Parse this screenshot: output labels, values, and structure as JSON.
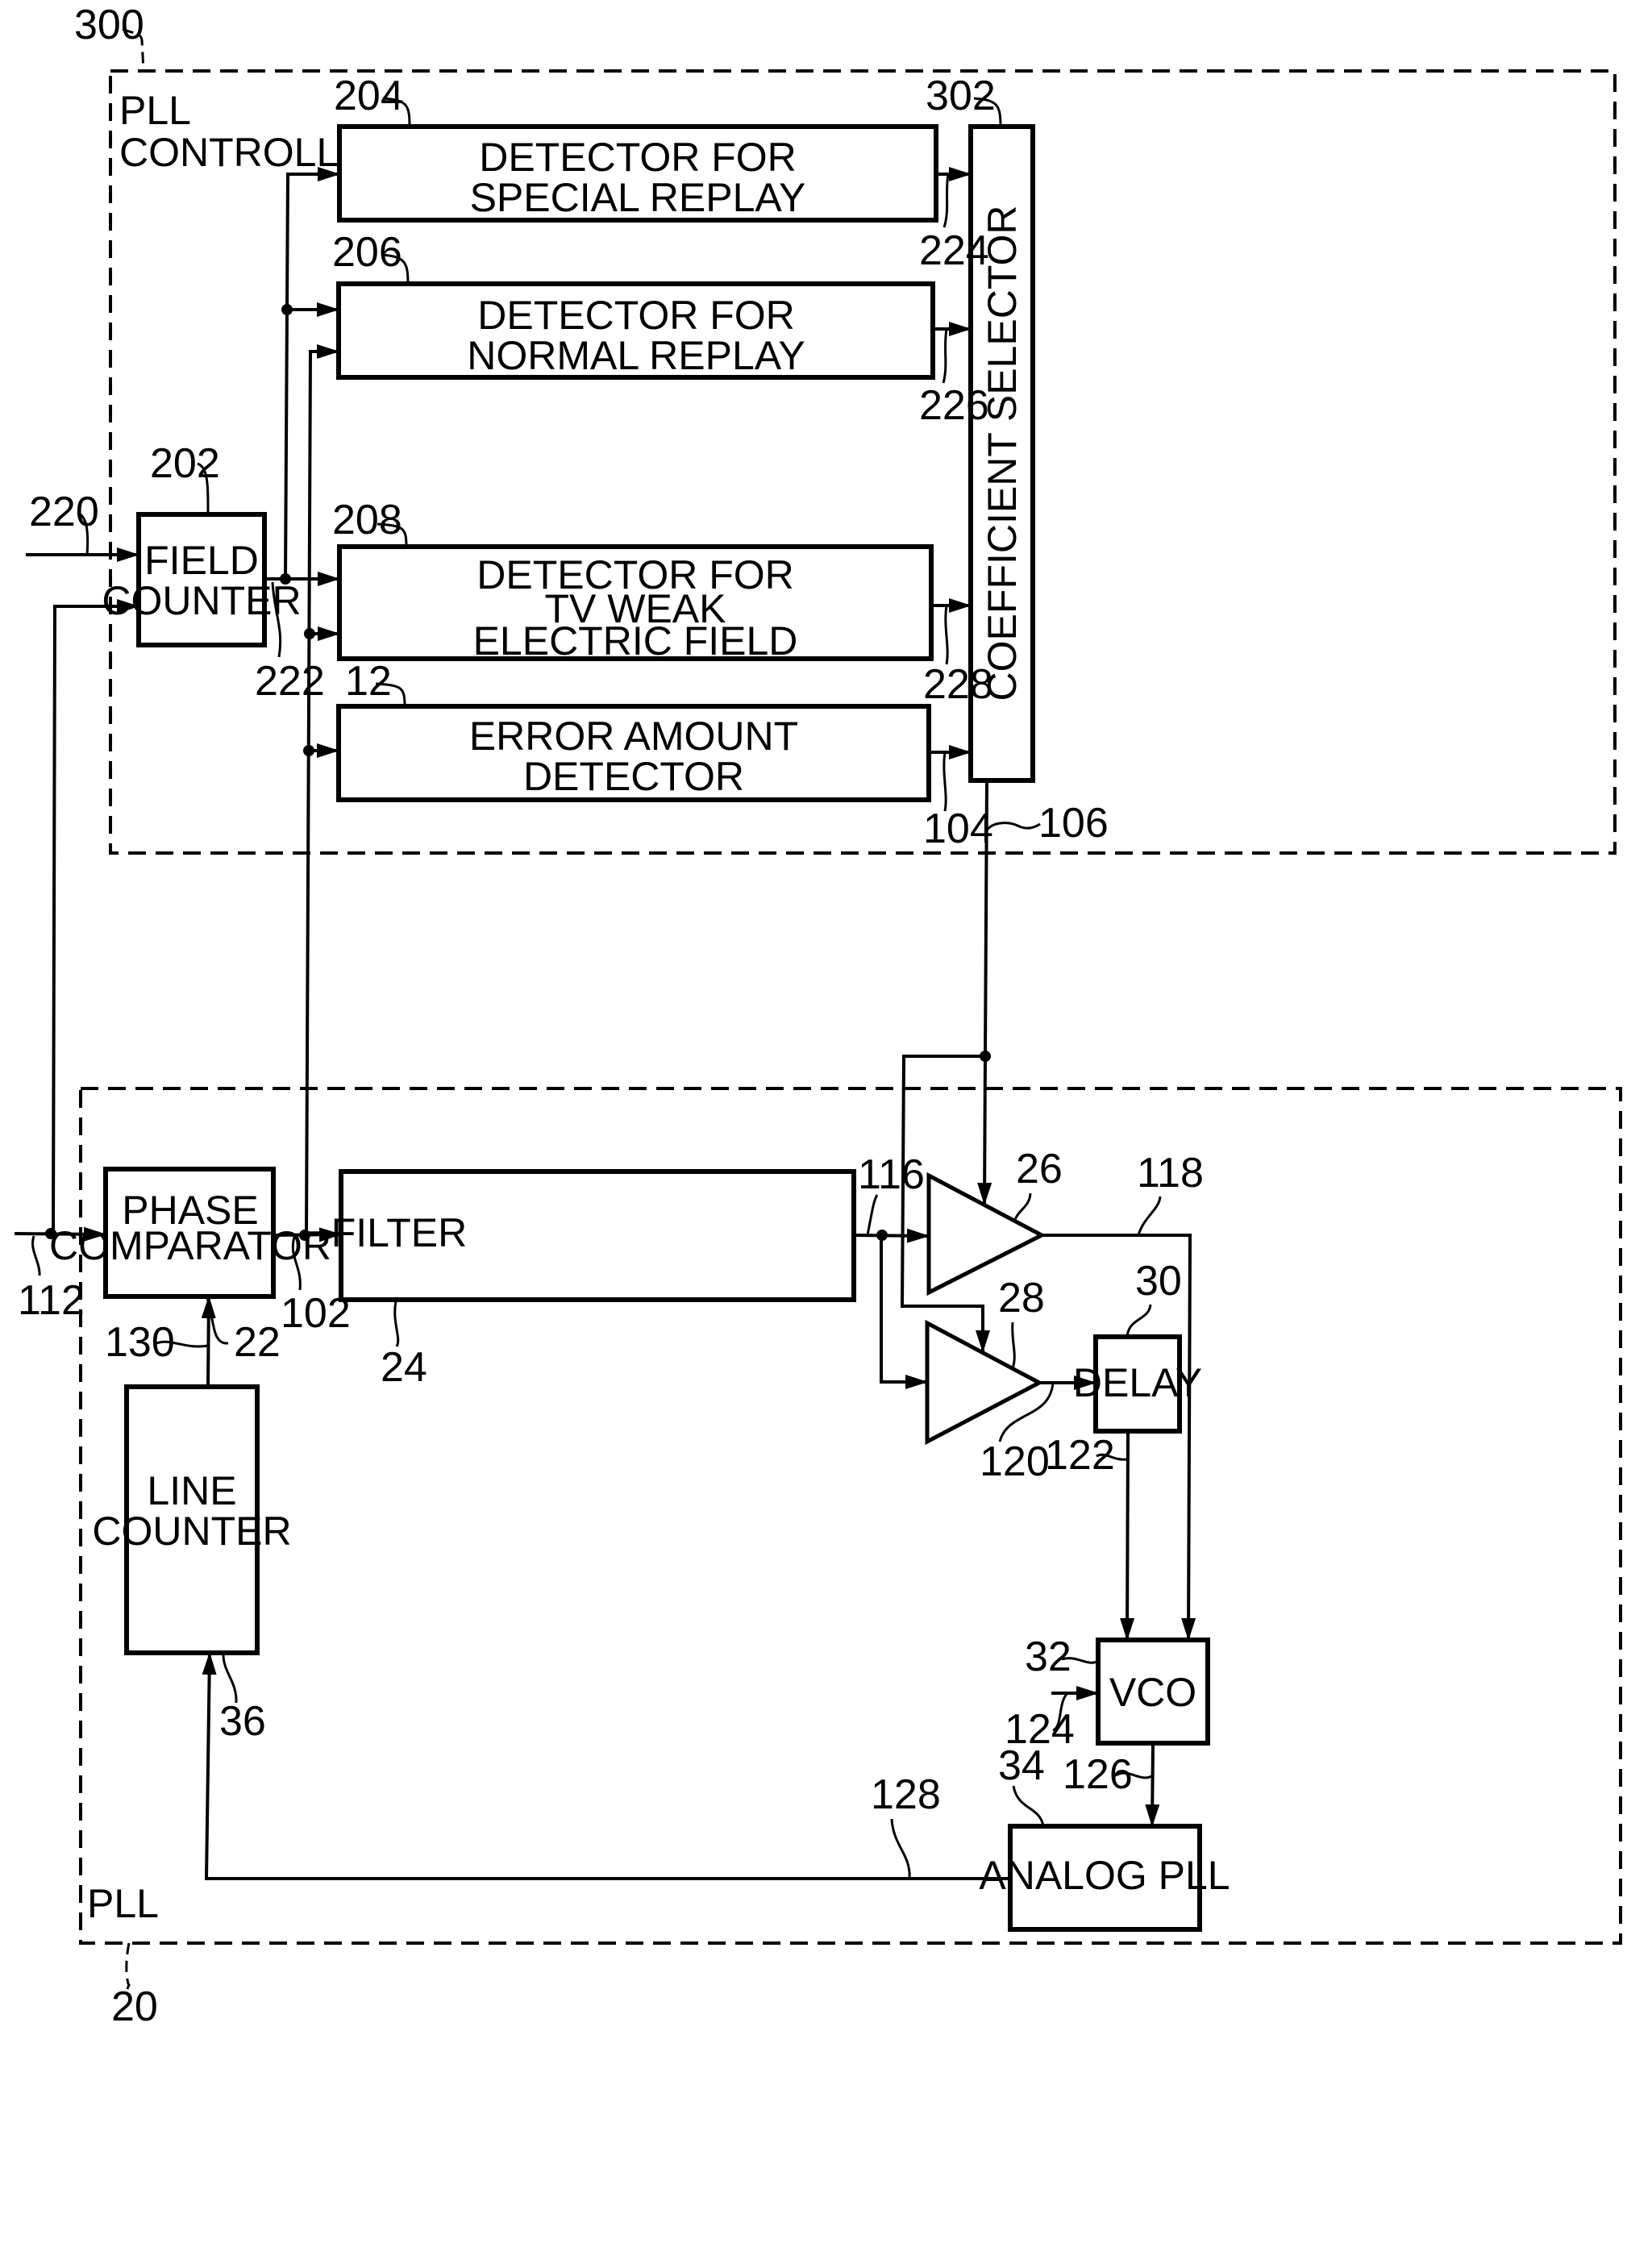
{
  "figure": {
    "groups": {
      "pll_controller": {
        "ref": "300",
        "title_line1": "PLL",
        "title_line2": "CONTROLLER"
      },
      "pll": {
        "ref": "20",
        "title": "PLL"
      }
    },
    "blocks": {
      "field_counter": {
        "ref": "202",
        "line1": "FIELD",
        "line2": "COUNTER"
      },
      "detector_special": {
        "ref": "204",
        "line1": "DETECTOR FOR",
        "line2": "SPECIAL REPLAY"
      },
      "detector_normal": {
        "ref": "206",
        "line1": "DETECTOR FOR",
        "line2": "NORMAL REPLAY"
      },
      "detector_weak": {
        "ref": "208",
        "line1": "DETECTOR FOR",
        "line2": "TV WEAK",
        "line3": "ELECTRIC FIELD"
      },
      "error_detector": {
        "ref": "12",
        "line1": "ERROR AMOUNT",
        "line2": "DETECTOR"
      },
      "coefficient_selector": {
        "ref": "302",
        "label": "COEFFICIENT SELECTOR"
      },
      "phase_comparator": {
        "ref": "22",
        "line1": "PHASE",
        "line2": "COMPARATOR"
      },
      "filter": {
        "ref": "24",
        "label": "FILTER"
      },
      "amp_upper": {
        "ref": "26"
      },
      "amp_lower": {
        "ref": "28"
      },
      "delay": {
        "ref": "30",
        "label": "DELAY"
      },
      "vco": {
        "ref": "32",
        "label": "VCO"
      },
      "analog_pll": {
        "ref": "34",
        "label": "ANALOG PLL"
      },
      "line_counter": {
        "ref": "36",
        "line1": "LINE",
        "line2": "COUNTER"
      }
    },
    "signals": {
      "s220": "220",
      "s222": "222",
      "s224": "224",
      "s226": "226",
      "s228": "228",
      "s104": "104",
      "s106": "106",
      "s112": "112",
      "s102": "102",
      "s116": "116",
      "s118": "118",
      "s120": "120",
      "s122": "122",
      "s124": "124",
      "s126": "126",
      "s128": "128",
      "s130": "130"
    }
  }
}
